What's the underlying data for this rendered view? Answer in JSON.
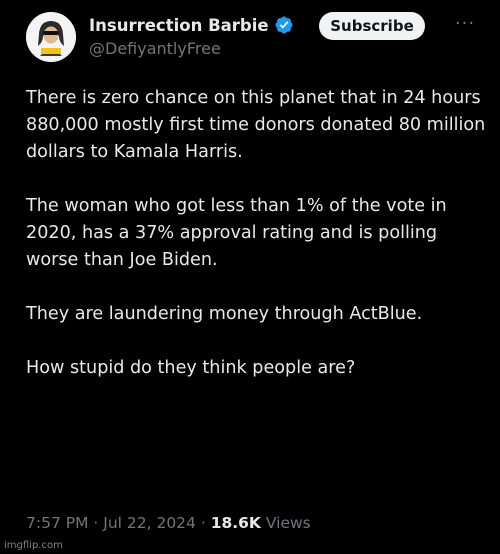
{
  "author": {
    "display_name": "Insurrection Barbie",
    "handle": "@DefiyantlyFree",
    "verified": true,
    "avatar_icon": "profile-avatar"
  },
  "actions": {
    "subscribe_label": "Subscribe",
    "more_icon": "···"
  },
  "tweet": {
    "paragraphs": [
      "There is zero chance on this planet that in 24 hours 880,000 mostly first time donors donated 80 million dollars to Kamala Harris.",
      "The woman who got less than 1% of the vote in 2020, has a 37% approval rating and is polling worse than Joe Biden.",
      "They are laundering money through ActBlue.",
      "How stupid do they think people are?"
    ]
  },
  "meta": {
    "time": "7:57 PM",
    "separator": " · ",
    "date": "Jul 22, 2024",
    "views_count": "18.6K",
    "views_label": " Views"
  },
  "watermark": "imgflip.com",
  "colors": {
    "background": "#000000",
    "text": "#e7e9ea",
    "secondary": "#71767b",
    "verified_badge": "#1d9bf0",
    "subscribe_bg": "#eff3f4"
  }
}
